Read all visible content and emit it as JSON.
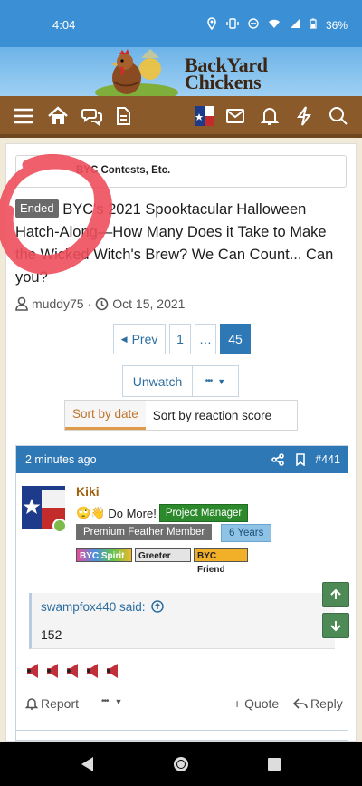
{
  "status_bar": {
    "time": "4:04",
    "battery": "36%"
  },
  "header": {
    "logo_line1": "BackYard",
    "logo_line2": "Chickens"
  },
  "breadcrumb": {
    "text": "BYC Contests, Etc."
  },
  "thread": {
    "prefix": "Ended",
    "title": "BYC's 2021 Spooktacular Halloween Hatch-Along—How Many Does it Take to Make the Wicked Witch's Brew? We Can Count... Can you?",
    "author": "muddy75",
    "separator": "·",
    "date": "Oct 15, 2021"
  },
  "pagination": {
    "prev": "Prev",
    "first": "1",
    "ellipsis": "…",
    "current": "45"
  },
  "watch": {
    "unwatch": "Unwatch",
    "more": "•••"
  },
  "sort": {
    "by_date": "Sort by date",
    "by_reaction": "Sort by reaction score"
  },
  "post": {
    "time_ago": "2 minutes ago",
    "number": "#441",
    "username": "Kiki",
    "user_title": "Do More!",
    "user_title_emoji": "🙄👋",
    "role_badge": "Project Manager",
    "member_badge": "Premium Feather Member",
    "years_badge": "6 Years",
    "mini_badges": [
      "BYC Spirit",
      "Greeter",
      "BYC Friend"
    ],
    "quote_author": "swampfox440 said:",
    "quote_text": "152",
    "reaction_count": 5,
    "actions": {
      "report": "Report",
      "more": "•••",
      "quote": "+ Quote",
      "reply": "Reply"
    }
  },
  "colors": {
    "accent_blue": "#2f78b6",
    "nav_brown": "#8a5a2b",
    "quote_button_green": "#4e8a56",
    "sort_active": "#c0732a"
  }
}
